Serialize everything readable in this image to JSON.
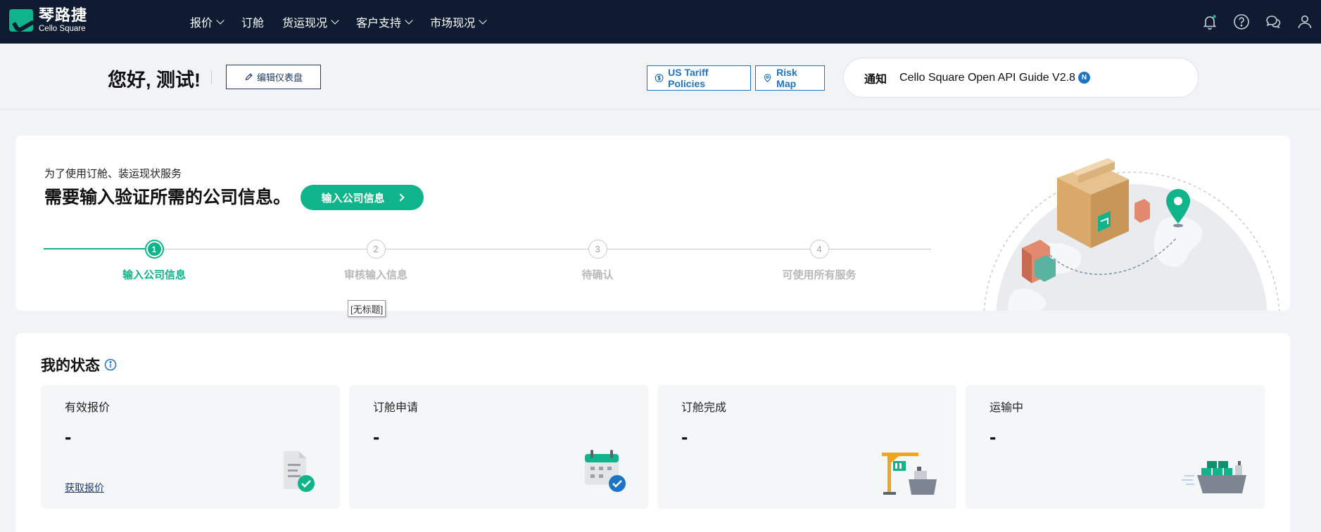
{
  "nav": {
    "logo_cn": "琴路捷",
    "logo_en": "Cello Square",
    "menu": [
      "报价",
      "订舱",
      "货运现况",
      "客户支持",
      "市场现况"
    ],
    "icons": [
      "bell-icon",
      "help-icon",
      "chat-icon",
      "user-icon"
    ]
  },
  "greeting": {
    "text": "您好, 测试!",
    "edit_button": "编辑仪表盘",
    "tariff_button": "US Tariff Policies",
    "riskmap_button": "Risk Map",
    "notice_label": "通知",
    "notice_text": "Cello Square Open API Guide V2.8",
    "notice_badge": "N"
  },
  "onboarding": {
    "subtitle": "为了使用订舱、装运现状服务",
    "title": "需要输入验证所需的公司信息。",
    "button": "输入公司信息",
    "steps": [
      {
        "num": "1",
        "label": "输入公司信息",
        "active": true
      },
      {
        "num": "2",
        "label": "审核输入信息",
        "active": false
      },
      {
        "num": "3",
        "label": "待确认",
        "active": false
      },
      {
        "num": "4",
        "label": "可使用所有服务",
        "active": false
      }
    ],
    "tooltip": "[无标题]"
  },
  "status": {
    "title": "我的状态",
    "tiles": [
      {
        "label": "有效报价",
        "value": "-",
        "link": "获取报价",
        "icon": "document-check-icon"
      },
      {
        "label": "订舱申请",
        "value": "-",
        "icon": "calendar-check-icon"
      },
      {
        "label": "订舱完成",
        "value": "-",
        "icon": "crane-ship-icon"
      },
      {
        "label": "运输中",
        "value": "-",
        "icon": "cargo-ship-icon"
      }
    ]
  },
  "colors": {
    "nav_bg": "#0f1b30",
    "brand_green": "#10b48a",
    "accent_blue": "#1c74c4"
  }
}
